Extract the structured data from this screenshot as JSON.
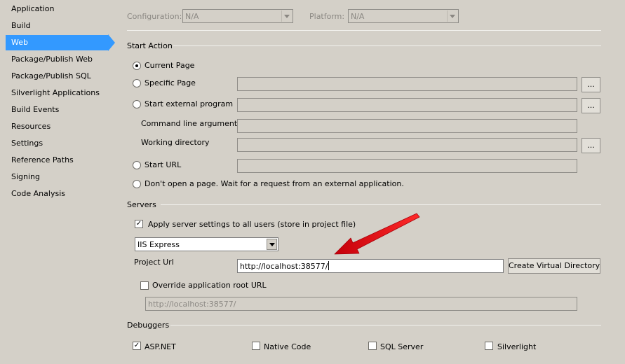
{
  "sidebar": {
    "items": [
      {
        "label": "Application"
      },
      {
        "label": "Build"
      },
      {
        "label": "Web"
      },
      {
        "label": "Package/Publish Web"
      },
      {
        "label": "Package/Publish SQL"
      },
      {
        "label": "Silverlight Applications"
      },
      {
        "label": "Build Events"
      },
      {
        "label": "Resources"
      },
      {
        "label": "Settings"
      },
      {
        "label": "Reference Paths"
      },
      {
        "label": "Signing"
      },
      {
        "label": "Code Analysis"
      }
    ],
    "active_label": "Web"
  },
  "config_bar": {
    "configuration_label": "Configuration:",
    "configuration_value": "N/A",
    "platform_label": "Platform:",
    "platform_value": "N/A"
  },
  "start_action": {
    "title": "Start Action",
    "current_page": "Current Page",
    "specific_page": "Specific Page",
    "start_external_program": "Start external program",
    "command_line_arguments": "Command line arguments",
    "working_directory": "Working directory",
    "start_url": "Start URL",
    "dont_open_page": "Don't open a page.  Wait for a request from an external application.",
    "browse_label": "...",
    "selected": "Current Page"
  },
  "servers": {
    "title": "Servers",
    "apply_all_users": "Apply server settings to all users (store in project file)",
    "apply_all_users_checked": true,
    "server_type": "IIS Express",
    "project_url_label": "Project Url",
    "project_url_value": "http://localhost:38577/",
    "create_virtual_directory": "Create Virtual Directory",
    "override_root_label": "Override application root URL",
    "override_root_checked": false,
    "override_root_value": "http://localhost:38577/"
  },
  "debuggers": {
    "title": "Debuggers",
    "aspnet": "ASP.NET",
    "aspnet_checked": true,
    "native_code": "Native Code",
    "native_code_checked": false,
    "sql_server": "SQL Server",
    "sql_server_checked": false,
    "silverlight": "Silverlight",
    "silverlight_checked": false
  },
  "colors": {
    "background": "#d4d0c8",
    "selection": "#3399ff",
    "annotation_arrow": "#e8141b"
  },
  "icons": {
    "annotation": "red-arrow-icon",
    "dropdown": "chevron-down-icon",
    "check": "checkmark-icon"
  }
}
